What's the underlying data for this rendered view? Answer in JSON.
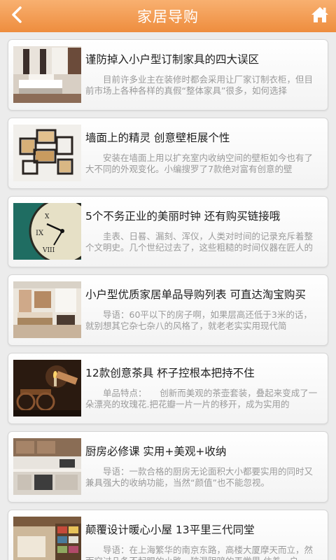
{
  "header": {
    "title": "家居导购",
    "back_icon": "chevron-left-icon",
    "home_icon": "home-icon",
    "color": "#f29a4d"
  },
  "articles": [
    {
      "title": "谨防掉入小户型订制家具的四大误区",
      "summary": "目前许多业主在装修时都会采用让厂家订制衣柜，但目前市场上各种各样的真假“整体家具”很多，如何选择",
      "thumb": "bedroom"
    },
    {
      "title": "墙面上的精灵 创意壁柜展个性",
      "summary": "安装在墙面上用以扩充室内收纳空间的壁柜如今也有了大不同的外观变化。小编搜罗了7款绝对富有创意的壁",
      "thumb": "wall-shelves"
    },
    {
      "title": "5个不务正业的美丽时钟 还有购买链接哦",
      "summary": "圭表、日晷、漏刻、浑仪，人类对时间的记录充斥着整个文明史。几个世纪过去了，这些粗糙的时间仪器在匠人的",
      "thumb": "clock"
    },
    {
      "title": "小户型优质家居单品导购列表 可直达淘宝购买",
      "summary": "导语：60平以下的房子啊，如果层高还低于3米的话，就别想其它杂七杂八的风格了，就老老实实用现代简",
      "thumb": "living-room"
    },
    {
      "title": "12款创意茶具 杯子控根本把持不住",
      "summary": "单品特点：　　创新而美观的茶壶套装，叠起来变成了一朵漂亮的玫瑰花.把花瓣一片一片的移开，成为实用的",
      "thumb": "tea-set"
    },
    {
      "title": "厨房必修课 实用+美观+收纳",
      "summary": "导语：一款合格的厨房无论面积大小都要实用的同时又兼具强大的收纳功能，当然“颜值”也不能忽视。",
      "thumb": "kitchen"
    },
    {
      "title": "颠覆设计暖心小屋 13平里三代同堂",
      "summary": "导语：在上海繁华的南京东路，高楼大厦摩天而立，然而穿过几条不起眼的小路，狭混阴暗的弄堂里 住着一户",
      "thumb": "bookshelf"
    }
  ]
}
